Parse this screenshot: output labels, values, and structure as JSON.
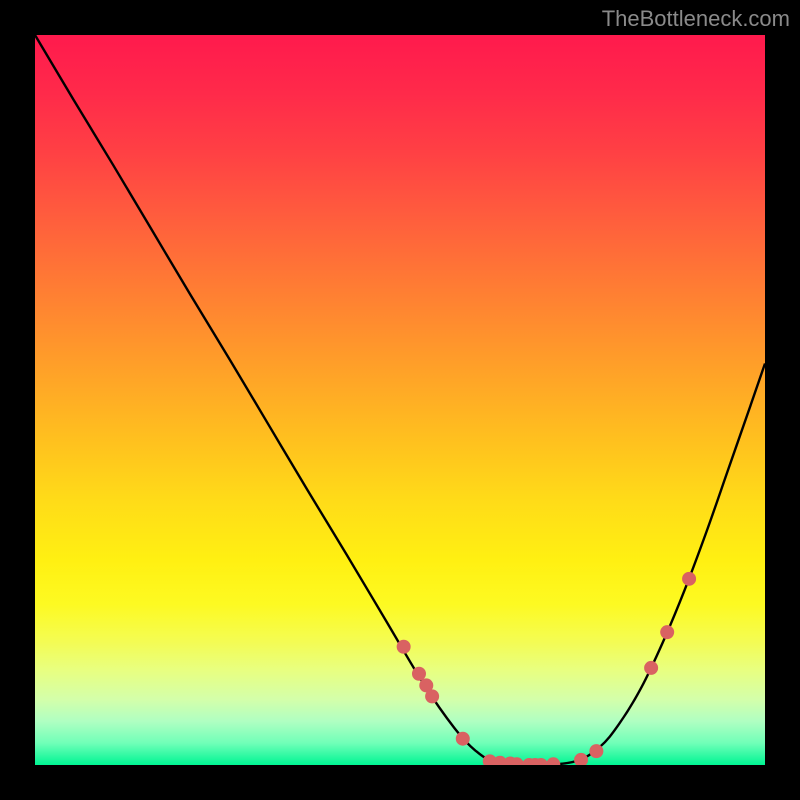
{
  "attribution": "TheBottleneck.com",
  "chart_data": {
    "type": "line",
    "title": "",
    "xlabel": "",
    "ylabel": "",
    "xlim": [
      0,
      100
    ],
    "ylim": [
      0,
      100
    ],
    "curve": [
      {
        "x": 0.0,
        "y": 100.0
      },
      {
        "x": 5.3,
        "y": 91.1
      },
      {
        "x": 10.7,
        "y": 82.2
      },
      {
        "x": 16.0,
        "y": 73.3
      },
      {
        "x": 21.3,
        "y": 64.4
      },
      {
        "x": 26.7,
        "y": 55.5
      },
      {
        "x": 32.0,
        "y": 46.6
      },
      {
        "x": 37.3,
        "y": 37.7
      },
      {
        "x": 42.7,
        "y": 28.8
      },
      {
        "x": 48.0,
        "y": 19.9
      },
      {
        "x": 53.3,
        "y": 11.0
      },
      {
        "x": 57.5,
        "y": 5.0
      },
      {
        "x": 60.3,
        "y": 2.0
      },
      {
        "x": 63.0,
        "y": 0.5
      },
      {
        "x": 68.5,
        "y": 0.0
      },
      {
        "x": 74.0,
        "y": 0.5
      },
      {
        "x": 77.4,
        "y": 2.5
      },
      {
        "x": 80.0,
        "y": 5.6
      },
      {
        "x": 83.0,
        "y": 10.5
      },
      {
        "x": 86.0,
        "y": 16.8
      },
      {
        "x": 89.0,
        "y": 24.0
      },
      {
        "x": 92.0,
        "y": 32.0
      },
      {
        "x": 95.0,
        "y": 40.6
      },
      {
        "x": 98.0,
        "y": 49.2
      },
      {
        "x": 100.0,
        "y": 55.0
      }
    ],
    "dots": [
      {
        "x": 50.5,
        "y": 16.2
      },
      {
        "x": 52.6,
        "y": 12.5
      },
      {
        "x": 53.6,
        "y": 10.9
      },
      {
        "x": 54.4,
        "y": 9.4
      },
      {
        "x": 58.6,
        "y": 3.6
      },
      {
        "x": 62.3,
        "y": 0.5
      },
      {
        "x": 63.7,
        "y": 0.3
      },
      {
        "x": 65.1,
        "y": 0.2
      },
      {
        "x": 66.0,
        "y": 0.1
      },
      {
        "x": 67.7,
        "y": 0.0
      },
      {
        "x": 68.5,
        "y": 0.0
      },
      {
        "x": 69.3,
        "y": 0.0
      },
      {
        "x": 71.0,
        "y": 0.1
      },
      {
        "x": 74.8,
        "y": 0.7
      },
      {
        "x": 76.9,
        "y": 1.9
      },
      {
        "x": 84.4,
        "y": 13.3
      },
      {
        "x": 86.6,
        "y": 18.2
      },
      {
        "x": 89.6,
        "y": 25.5
      }
    ],
    "colors": {
      "curve": "#000000",
      "dots": "#d96262"
    }
  }
}
